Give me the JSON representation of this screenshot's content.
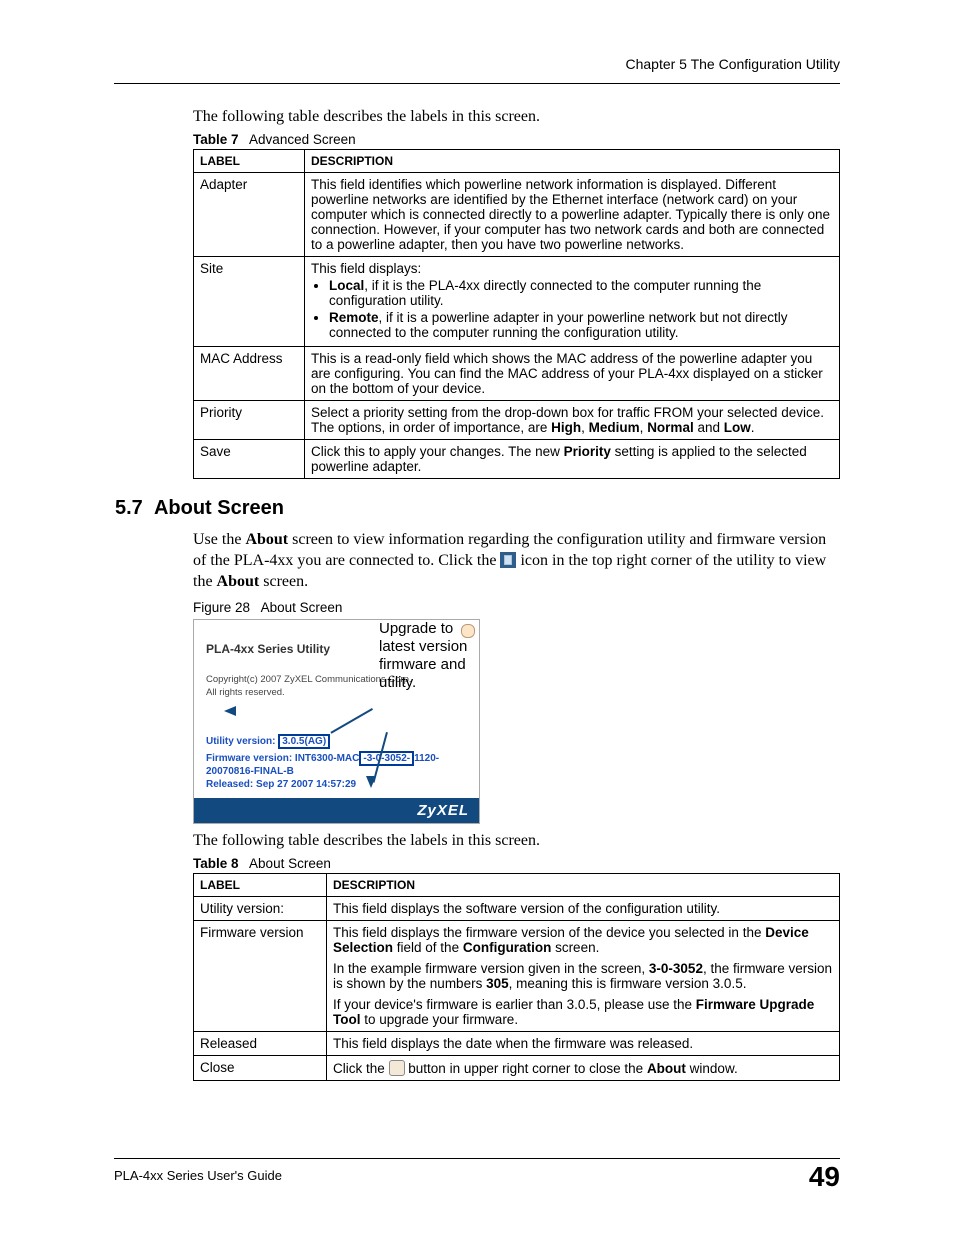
{
  "header": {
    "chapter": "Chapter 5 The Configuration Utility"
  },
  "intro1": "The following table describes the labels in this screen.",
  "table7": {
    "caption_num": "Table 7",
    "caption_title": "Advanced Screen",
    "col1": "LABEL",
    "col2": "DESCRIPTION",
    "rows": {
      "adapter": {
        "label": "Adapter",
        "desc": "This field identifies which powerline network information is displayed. Different powerline networks are identified by the Ethernet interface (network card) on your computer which is connected directly to a powerline adapter. Typically there is only one connection. However, if your computer has two network cards and both are connected to a powerline adapter, then you have two powerline networks."
      },
      "site": {
        "label": "Site",
        "desc_intro": "This field displays:",
        "bullet1_bold": "Local",
        "bullet1_rest": ", if it is the PLA-4xx directly connected to the computer running the configuration utility.",
        "bullet2_bold": "Remote",
        "bullet2_rest": ", if it is a powerline adapter in your powerline network but not directly connected to the computer running the configuration utility."
      },
      "mac": {
        "label": "MAC Address",
        "desc": "This is a read-only field which shows the MAC address of the powerline adapter you are configuring. You can find the MAC address of your PLA-4xx displayed on a sticker on the bottom of your device."
      },
      "priority": {
        "label": "Priority",
        "desc_a": "Select a priority setting from the drop-down box for traffic FROM your selected device. The options, in order of importance, are ",
        "b1": "High",
        "c1": ", ",
        "b2": "Medium",
        "c2": ", ",
        "b3": "Normal",
        "c3": " and ",
        "b4": "Low",
        "c4": "."
      },
      "save": {
        "label": "Save",
        "desc_a": "Click this to apply your changes. The new ",
        "b1": "Priority",
        "desc_b": " setting is applied to the selected powerline adapter."
      }
    }
  },
  "section": {
    "num": "5.7",
    "title": "About Screen"
  },
  "para_about_a": "Use the ",
  "para_about_b": "About",
  "para_about_c": " screen to view information regarding the configuration utility and firmware version of the PLA-4xx you are connected to. Click the ",
  "para_about_d": " icon in the top right corner of the utility to view the ",
  "para_about_e": "About",
  "para_about_f": " screen.",
  "figure": {
    "num": "Figure 28",
    "title": "About Screen"
  },
  "about_box": {
    "title": "PLA-4xx Series Utility",
    "copy1": "Copyright(c) 2007 ZyXEL Communications Corp.",
    "copy2": "All rights reserved.",
    "util_label": "Utility version: ",
    "util_value": "3.0.5(AG)",
    "fw_label": "Firmware version: ",
    "fw_a": "INT6300-MAC",
    "fw_b": "-3-0-3052-",
    "fw_c": "1120-20070816-FINAL-B",
    "rel_label": "Released: ",
    "rel_value": "Sep 27 2007 14:57:29",
    "brand": "ZyXEL",
    "callout": "Upgrade to latest version firmware and utility."
  },
  "intro2": "The following table describes the labels in this screen.",
  "table8": {
    "caption_num": "Table 8",
    "caption_title": "About Screen",
    "col1": "LABEL",
    "col2": "DESCRIPTION",
    "rows": {
      "util": {
        "label": "Utility version:",
        "desc": "This field displays the software version of the configuration utility."
      },
      "fw": {
        "label": "Firmware version",
        "p1a": "This field displays the firmware version of the device you selected in the ",
        "p1b": "Device Selection",
        "p1c": " field of the ",
        "p1d": "Configuration",
        "p1e": " screen.",
        "p2a": "In the example firmware version given in the screen, ",
        "p2b": "3-0-3052",
        "p2c": ", the firmware version is shown by the numbers ",
        "p2d": "305",
        "p2e": ", meaning this is firmware version 3.0.5.",
        "p3a": "If your device's firmware is earlier than 3.0.5, please use the ",
        "p3b": "Firmware Upgrade Tool",
        "p3c": " to upgrade your firmware."
      },
      "rel": {
        "label": "Released",
        "desc": "This field displays the date when the firmware was released."
      },
      "close": {
        "label": "Close",
        "desc_a": "Click the ",
        "desc_b": " button in upper right corner to close the ",
        "desc_c": "About",
        "desc_d": " window."
      }
    }
  },
  "footer": {
    "left": "PLA-4xx Series User's Guide",
    "pagenum": "49"
  }
}
